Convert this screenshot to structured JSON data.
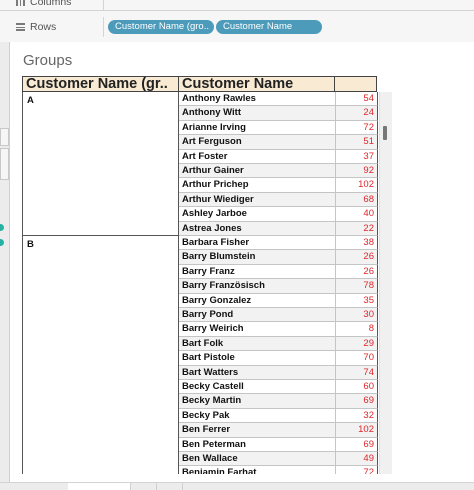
{
  "shelves": {
    "columns_label": "Columns",
    "rows_label": "Rows",
    "row_pills": [
      "Customer Name (gro..",
      "Customer Name"
    ]
  },
  "sheet": {
    "title": "Groups",
    "headers": [
      "Customer Name (gr..",
      "Customer Name",
      ""
    ],
    "groups": [
      {
        "label": "A",
        "rows": [
          {
            "name": "Anthony Rawles",
            "value": "54"
          },
          {
            "name": "Anthony Witt",
            "value": "24"
          },
          {
            "name": "Arianne Irving",
            "value": "72"
          },
          {
            "name": "Art Ferguson",
            "value": "51"
          },
          {
            "name": "Art Foster",
            "value": "37"
          },
          {
            "name": "Arthur Gainer",
            "value": "92"
          },
          {
            "name": "Arthur Prichep",
            "value": "102"
          },
          {
            "name": "Arthur Wiediger",
            "value": "68"
          },
          {
            "name": "Ashley Jarboe",
            "value": "40"
          },
          {
            "name": "Astrea Jones",
            "value": "22"
          }
        ]
      },
      {
        "label": "B",
        "rows": [
          {
            "name": "Barbara Fisher",
            "value": "38"
          },
          {
            "name": "Barry Blumstein",
            "value": "26"
          },
          {
            "name": "Barry Franz",
            "value": "26"
          },
          {
            "name": "Barry Französisch",
            "value": "78"
          },
          {
            "name": "Barry Gonzalez",
            "value": "35"
          },
          {
            "name": "Barry Pond",
            "value": "30"
          },
          {
            "name": "Barry Weirich",
            "value": "8"
          },
          {
            "name": "Bart Folk",
            "value": "29"
          },
          {
            "name": "Bart Pistole",
            "value": "70"
          },
          {
            "name": "Bart Watters",
            "value": "74"
          },
          {
            "name": "Becky Castell",
            "value": "60"
          },
          {
            "name": "Becky Martin",
            "value": "69"
          },
          {
            "name": "Becky Pak",
            "value": "32"
          },
          {
            "name": "Ben Ferrer",
            "value": "102"
          },
          {
            "name": "Ben Peterman",
            "value": "69"
          },
          {
            "name": "Ben Wallace",
            "value": "49"
          },
          {
            "name": "Benjamin Farhat",
            "value": "72"
          }
        ]
      }
    ]
  }
}
